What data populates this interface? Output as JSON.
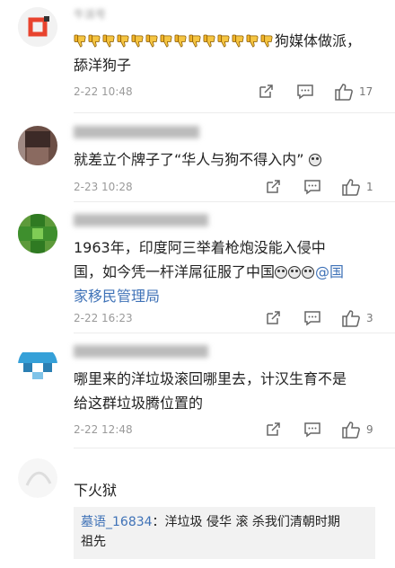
{
  "comments": [
    {
      "username": "牛派号",
      "text_lines": [
        "狗媒体做派，",
        "舔洋狗子"
      ],
      "thumbs_down_count": 14,
      "time": "2-22 10:48",
      "likes": "17"
    },
    {
      "username": "",
      "text_lines": [
        "就差立个牌子了“华人与狗不得入内”"
      ],
      "time": "2-23 10:28",
      "likes": "1"
    },
    {
      "username": "",
      "text_lines": [
        "1963年，印度阿三举着枪炮没能入侵中",
        "国，如今凭一杆洋屌征服了中国",
        "家移民管理局"
      ],
      "mention": "@国",
      "time": "2-22 16:23",
      "likes": "3"
    },
    {
      "username": "",
      "text_lines": [
        "哪里来的洋垃圾滚回哪里去，计汉生育不是",
        "给这群垃圾腾位置的"
      ],
      "time": "2-22 12:48",
      "likes": "9"
    },
    {
      "username": "",
      "text_lines": [
        "下火狱"
      ]
    }
  ],
  "reply": {
    "author": "墓语_16834",
    "text_line1": "：洋垃圾 侵华  滚 杀我们清朝时期",
    "text_line2": "祖先"
  },
  "icons": [
    "share-icon",
    "comment-icon",
    "like-icon",
    "thumbs-down-emoji-icon",
    "laughing-emoji-icon"
  ],
  "colors": {
    "mention": "#3f72b7",
    "muted": "#9a9a9a",
    "reply_bg": "#f2f2f2"
  }
}
